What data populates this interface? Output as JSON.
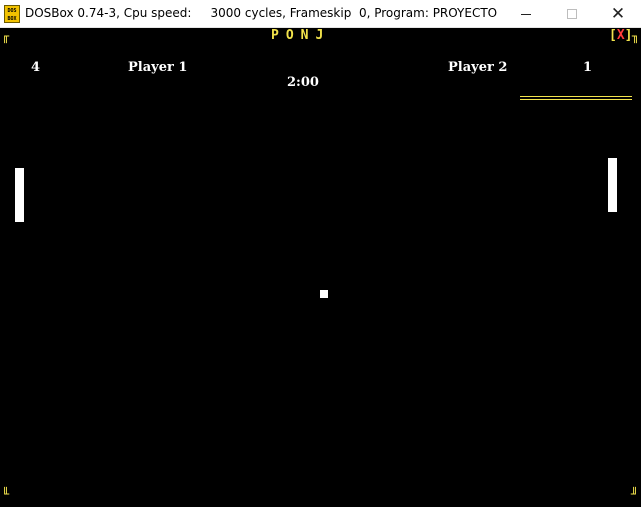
{
  "window": {
    "icon_text": "DOS BOX",
    "title": "DOSBox 0.74-3, Cpu speed:     3000 cycles, Frameskip  0, Program: PROYECTO",
    "controls": {
      "minimize": "—",
      "maximize": "☐",
      "close": "✕"
    }
  },
  "game": {
    "title": "PONJ",
    "close_label": "X",
    "timer": "2:00",
    "player1": {
      "label": "Player 1",
      "score": "4"
    },
    "player2": {
      "label": "Player 2",
      "score": "1"
    }
  },
  "colors": {
    "screen_bg": "#000000",
    "accent_yellow": "#f1e24b",
    "close_red": "#ff3b3b",
    "paddle": "#ffffff"
  }
}
